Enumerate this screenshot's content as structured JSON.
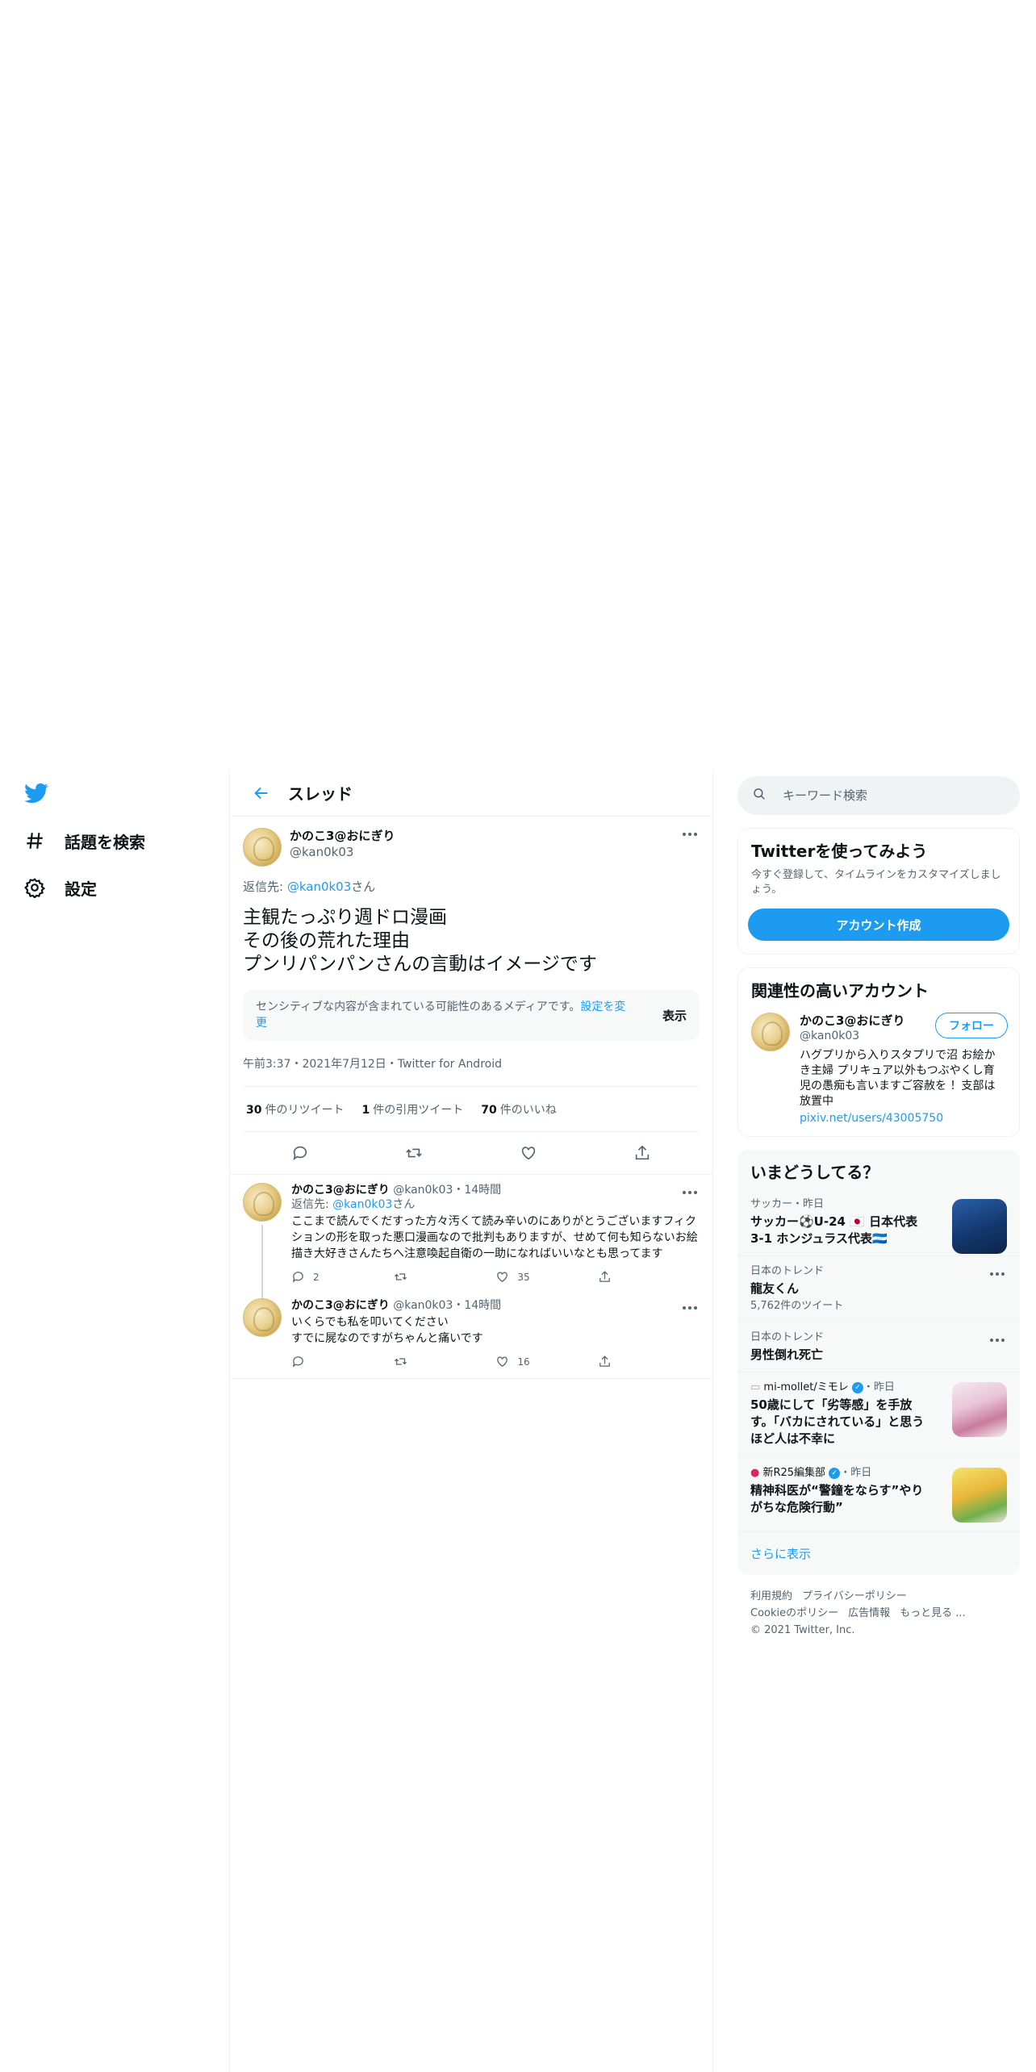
{
  "nav": {
    "explore": "話題を検索",
    "settings": "設定"
  },
  "header": {
    "title": "スレッド"
  },
  "focus_tweet": {
    "display_name": "かのこ3@おにぎり",
    "username": "@kan0k03",
    "reply_prefix": "返信先: ",
    "reply_to": "@kan0k03",
    "reply_suffix": "さん",
    "text_line1": "主観たっぷり週ドロ漫画",
    "text_line2": "その後の荒れた理由",
    "text_line3": "プンリパンパンさんの言動はイメージです",
    "sensitive_msg": "センシティブな内容が含まれている可能性のあるメディアです。",
    "sensitive_link": "設定を変更",
    "show_label": "表示",
    "meta": "午前3:37・2021年7月12日・Twitter for Android",
    "retweets": "30",
    "retweets_label": "件のリツイート",
    "quotes": "1",
    "quotes_label": "件の引用ツイート",
    "likes": "70",
    "likes_label": "件のいいね"
  },
  "replies": [
    {
      "display_name": "かのこ3@おにぎり",
      "username": "@kan0k03",
      "time": "・14時間",
      "reply_prefix": "返信先: ",
      "reply_to": "@kan0k03",
      "reply_suffix": "さん",
      "text": "ここまで読んでくだすった方々汚くて読み辛いのにありがとうございますフィクションの形を取った悪口漫画なので批判もありますが、せめて何も知らないお絵描き大好きさんたちへ注意喚起自衛の一助になればいいなとも思ってます",
      "reply_count": "2",
      "retweet_count": "",
      "like_count": "35"
    },
    {
      "display_name": "かのこ3@おにぎり",
      "username": "@kan0k03",
      "time": "・14時間",
      "text_line1": "いくらでも私を叩いてください",
      "text_line2": "すでに屍なのですがちゃんと痛いです",
      "reply_count": "",
      "retweet_count": "",
      "like_count": "16"
    }
  ],
  "search": {
    "placeholder": "キーワード検索"
  },
  "signup": {
    "title": "Twitterを使ってみよう",
    "subtitle": "今すぐ登録して、タイムラインをカスタマイズしましょう。",
    "button": "アカウント作成"
  },
  "related": {
    "title": "関連性の高いアカウント",
    "display_name": "かのこ3@おにぎり",
    "username": "@kan0k03",
    "follow": "フォロー",
    "bio": "ハグプリから入りスタプリで沼 お絵かき主婦 プリキュア以外もつぶやくし育児の愚痴も言いますご容赦を ！支部は放置中",
    "link": "pixiv.net/users/43005750"
  },
  "trends": {
    "title": "いまどうしてる？",
    "items": [
      {
        "context": "サッカー・昨日",
        "title": "サッカー⚽U-24 🇯🇵 日本代表 3-1 ホンジュラス代表🇭🇳",
        "count": ""
      },
      {
        "context": "日本のトレンド",
        "title": "龍友くん",
        "count": "5,762件のツイート"
      },
      {
        "context": "日本のトレンド",
        "title": "男性倒れ死亡",
        "count": ""
      },
      {
        "context": "mi-mollet/ミモレ",
        "context_suffix": "・昨日",
        "title": "50歳にして「劣等感」を手放す。「バカにされている」と思うほど人は不幸に",
        "count": ""
      },
      {
        "context": "新R25編集部",
        "context_suffix": "・昨日",
        "title": "精神科医が“警鐘をならす”やりがちな危険行動”",
        "count": ""
      }
    ],
    "show_more": "さらに表示"
  },
  "footer": {
    "terms": "利用規約",
    "privacy": "プライバシーポリシー",
    "cookie": "Cookieのポリシー",
    "ads": "広告情報",
    "more": "もっと見る ...",
    "copyright": "© 2021 Twitter, Inc."
  },
  "colors": {
    "accent": "#1d9bf0",
    "text": "#0f1419",
    "secondary": "#536471"
  }
}
